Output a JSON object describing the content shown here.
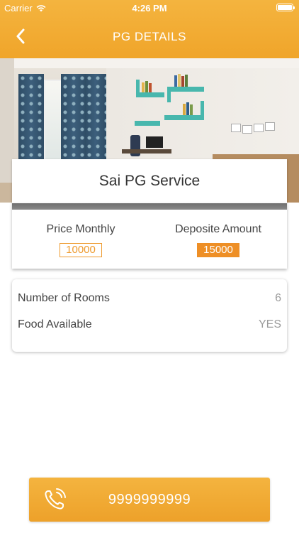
{
  "status_bar": {
    "carrier": "Carrier",
    "time": "4:26 PM"
  },
  "nav": {
    "title": "PG DETAILS",
    "back_icon": "chevron-left-icon"
  },
  "colors": {
    "accent": "#f0a52a",
    "badge_filled": "#ee8f26"
  },
  "pg": {
    "name": "Sai PG Service",
    "price_monthly_label": "Price Monthly",
    "price_monthly_value": "10000",
    "deposit_label": "Deposite Amount",
    "deposit_value": "15000"
  },
  "details": [
    {
      "label": "Number of Rooms",
      "value": "6"
    },
    {
      "label": "Food Available",
      "value": "YES"
    }
  ],
  "call": {
    "icon": "phone-ringing-icon",
    "number": "9999999999"
  }
}
